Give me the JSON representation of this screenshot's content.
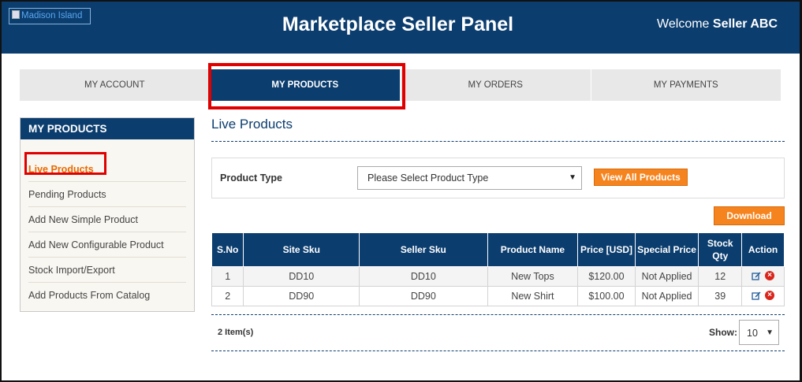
{
  "header": {
    "logo_alt": "Madison Island",
    "title": "Marketplace Seller Panel",
    "welcome_prefix": "Welcome",
    "seller_name": "Seller ABC"
  },
  "topnav": {
    "tabs": [
      {
        "label": "MY ACCOUNT"
      },
      {
        "label": "MY PRODUCTS"
      },
      {
        "label": "MY ORDERS"
      },
      {
        "label": "MY PAYMENTS"
      }
    ],
    "active": "MY PRODUCTS"
  },
  "sidebar": {
    "heading": "MY PRODUCTS",
    "items": [
      {
        "label": "Live Products"
      },
      {
        "label": "Pending Products"
      },
      {
        "label": "Add New Simple Product"
      },
      {
        "label": "Add New Configurable Product"
      },
      {
        "label": "Stock Import/Export"
      },
      {
        "label": "Add Products From Catalog"
      }
    ],
    "active": "Live Products"
  },
  "main": {
    "title": "Live Products",
    "filter": {
      "label": "Product Type",
      "select_value": "Please Select Product Type",
      "view_all_label": "View All Products"
    },
    "download_label": "Download",
    "table": {
      "headers": [
        "S.No",
        "Site Sku",
        "Seller Sku",
        "Product Name",
        "Price [USD]",
        "Special Price",
        "Stock Qty",
        "Action"
      ],
      "rows": [
        {
          "sno": "1",
          "site_sku": "DD10",
          "seller_sku": "DD10",
          "name": "New Tops",
          "price": "$120.00",
          "special": "Not Applied",
          "qty": "12"
        },
        {
          "sno": "2",
          "site_sku": "DD90",
          "seller_sku": "DD90",
          "name": "New Shirt",
          "price": "$100.00",
          "special": "Not Applied",
          "qty": "39"
        }
      ]
    },
    "pager": {
      "items_count": "2 Item(s)",
      "show_label": "Show:",
      "per_page": "10"
    }
  },
  "colors": {
    "brand_navy": "#0b3d6e",
    "accent_orange": "#f5841f",
    "highlight_red": "#e00000"
  }
}
